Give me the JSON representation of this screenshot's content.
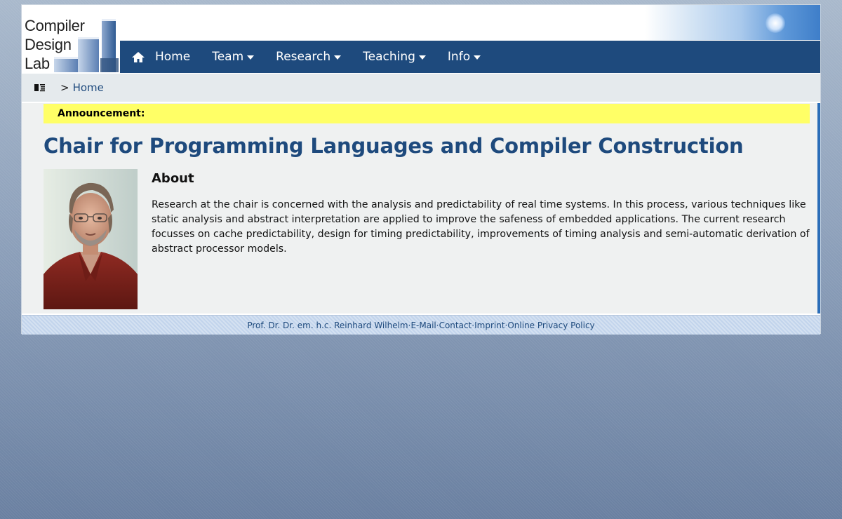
{
  "logo": {
    "lines": [
      "Compiler",
      "Design",
      "Lab"
    ]
  },
  "nav": {
    "items": [
      {
        "label": "Home",
        "icon": "home-icon",
        "dropdown": false
      },
      {
        "label": "Team",
        "dropdown": true
      },
      {
        "label": "Research",
        "dropdown": true
      },
      {
        "label": "Teaching",
        "dropdown": true
      },
      {
        "label": "Info",
        "dropdown": true
      }
    ]
  },
  "breadcrumb": {
    "separator": ">",
    "items": [
      "Home"
    ]
  },
  "announcement": {
    "label": "Announcement:"
  },
  "main": {
    "title": "Chair for Programming Languages and Compiler Construction",
    "about_heading": "About",
    "about_text": "Research at the chair is concerned with the analysis and predictability of real time systems. In this process, various techniques like static analysis and abstract interpretation are applied to improve the safeness of embedded applications. The current research focusses on cache predictability, design for timing predictability, improvements of timing analysis and semi-automatic derivation of abstract processor models."
  },
  "footer": {
    "name": "Prof. Dr. Dr. em. h.c. Reinhard Wilhelm",
    "sep1": " · ",
    "email": "E-Mail",
    "sep2": " · ",
    "contact": "Contact",
    "sep3": "· ",
    "imprint": "Imprint",
    "sep4": "· ",
    "privacy": "Online Privacy Policy"
  },
  "colors": {
    "brand": "#1e4a7d",
    "announcement_bg": "#ffff66",
    "content_bg": "#eff1f1",
    "accent_border": "#2a6db8"
  }
}
